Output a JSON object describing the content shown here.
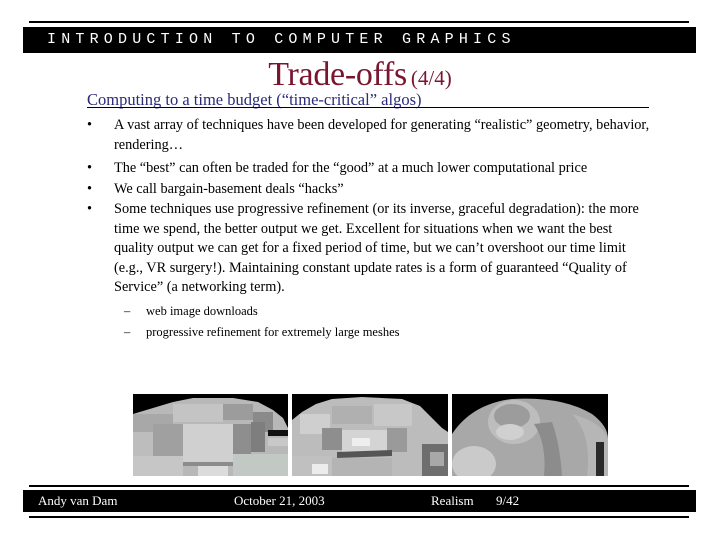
{
  "header": {
    "course_title": "INTRODUCTION TO COMPUTER GRAPHICS"
  },
  "slide": {
    "title": "Trade-offs",
    "title_counter": "(4/4)",
    "subtitle": "Computing to a time budget (“time-critical” algos)",
    "bullet_glyph": "•",
    "dash_glyph": "–",
    "bullets": [
      "A vast array of techniques have been developed for generating “realistic” geometry, behavior, rendering…",
      "The “best” can often be traded for the “good” at a much lower computational price",
      "We call bargain-basement deals “hacks”",
      "Some techniques use progressive refinement (or its inverse, graceful degradation): the more time we spend, the better output we get.  Excellent for situations when we want the best quality output we can get for a fixed period of time, but we can’t overshoot our time limit (e.g., VR surgery!). Maintaining constant update rates is a form of guaranteed “Quality of Service” (a networking term)."
    ],
    "sub_bullets": [
      "web image downloads",
      "progressive refinement for extremely large meshes"
    ],
    "images": [
      {
        "description": "coarse progressive mesh render (low detail)"
      },
      {
        "description": "medium progressive mesh render"
      },
      {
        "description": "fine progressive mesh render (high detail sculpture)"
      }
    ]
  },
  "footer": {
    "author": "Andy van Dam",
    "date": "October 21, 2003",
    "topic": "Realism",
    "page": "9/42"
  },
  "colors": {
    "title": "#7a1530",
    "subtitle": "#2a2a7a",
    "bar": "#000000"
  }
}
